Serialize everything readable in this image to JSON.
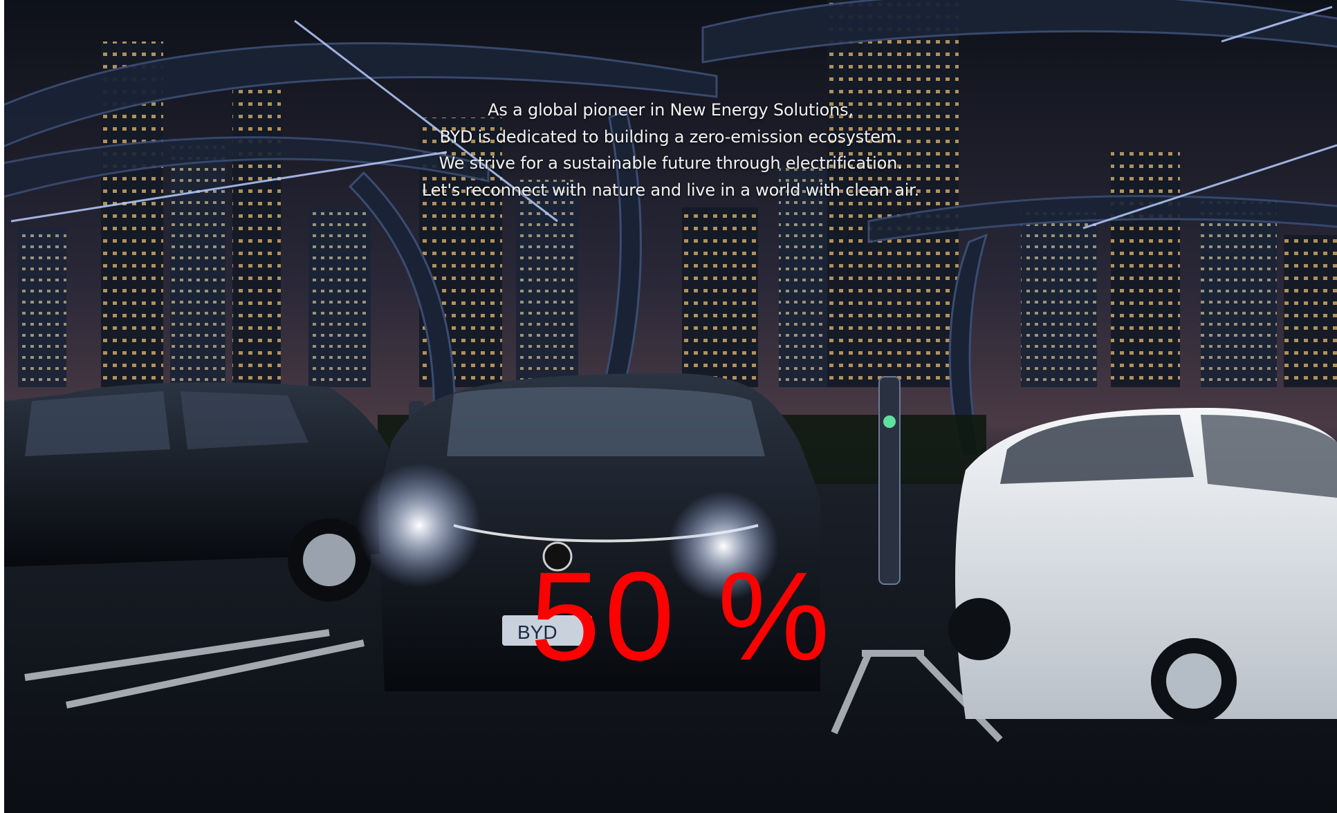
{
  "intro": {
    "lines": [
      "As a global pioneer in New Energy Solutions,",
      "BYD is dedicated to building a zero-emission ecosystem.",
      "We strive for a sustainable future through electrification.",
      "Let's reconnect with nature and live in a world with clean air."
    ]
  },
  "loader": {
    "progress_percent": 50,
    "label": "50 %",
    "color": "#ff0000"
  },
  "background": {
    "plate_text": "BYD"
  }
}
